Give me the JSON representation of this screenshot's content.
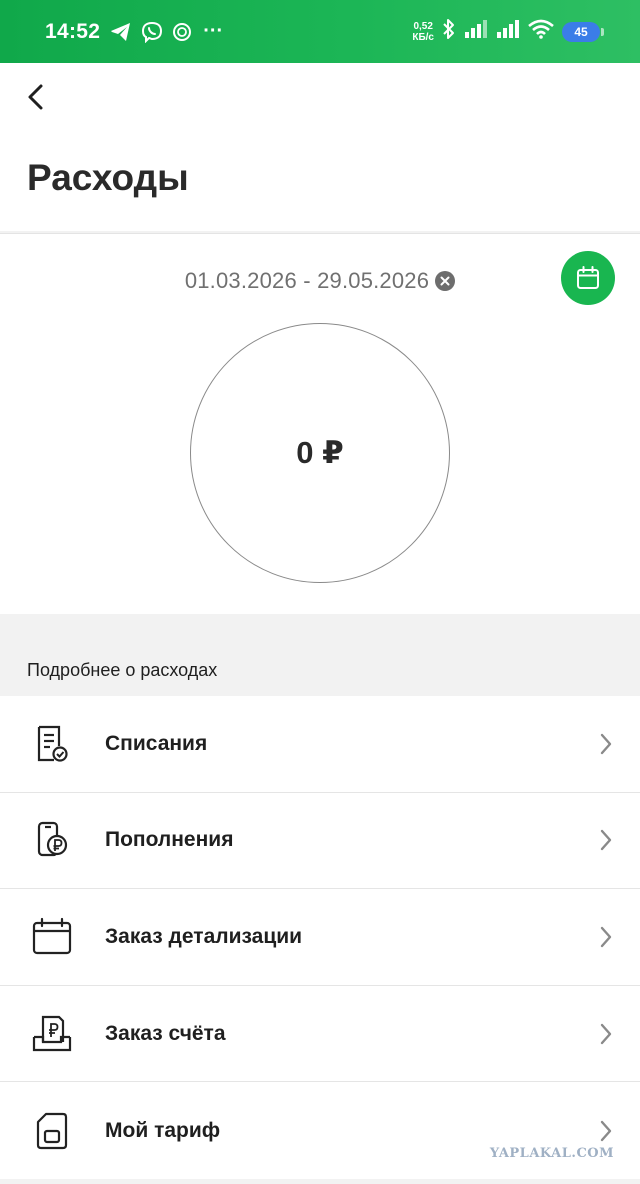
{
  "status_bar": {
    "time": "14:52",
    "net_speed_value": "0,52",
    "net_speed_unit": "КБ/с",
    "battery_level": "45",
    "icons": [
      "telegram-icon",
      "viber-icon",
      "app-icon",
      "bluetooth-icon",
      "signal-icon",
      "wifi-icon",
      "battery-icon"
    ]
  },
  "header": {
    "title": "Расходы"
  },
  "summary": {
    "date_range": "01.03.2026 - 29.05.2026",
    "total": "0 ₽"
  },
  "section": {
    "title": "Подробнее о расходах"
  },
  "menu": {
    "items": [
      {
        "label": "Списания",
        "icon": "receipt-check-icon"
      },
      {
        "label": "Пополнения",
        "icon": "phone-ruble-icon"
      },
      {
        "label": "Заказ детализации",
        "icon": "calendar-icon"
      },
      {
        "label": "Заказ счёта",
        "icon": "bill-tray-icon"
      },
      {
        "label": "Мой тариф",
        "icon": "sim-card-icon"
      }
    ]
  },
  "watermark": "YAPLAKAL.COM",
  "colors": {
    "accent": "#19b650",
    "status_bar": "#1cb656",
    "battery": "#3b7de8"
  }
}
